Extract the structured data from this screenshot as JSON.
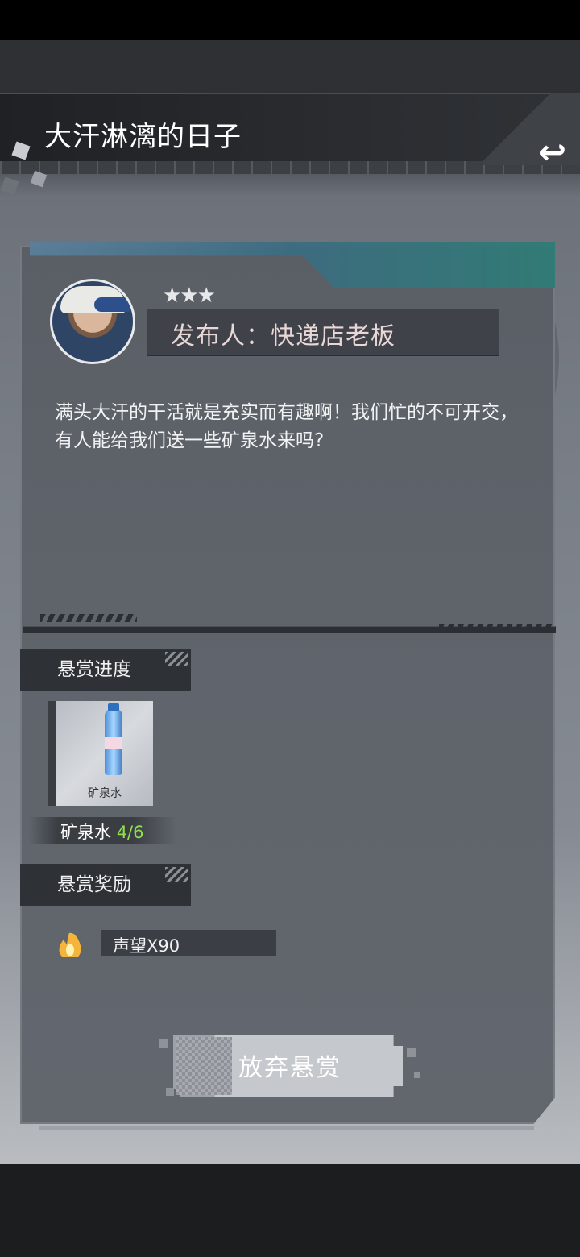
{
  "header": {
    "title": "大汗淋漓的日子",
    "back_icon": "↩"
  },
  "publisher": {
    "stars": "★★★",
    "label": "发布人：快递店老板"
  },
  "description": "满头大汗的干活就是充实而有趣啊！我们忙的不可开交，有人能给我们送一些矿泉水来吗?",
  "progress": {
    "section_label": "悬赏进度",
    "item_card_name": "矿泉水",
    "item_name": "矿泉水",
    "item_count": "4/6"
  },
  "reward": {
    "section_label": "悬赏奖励",
    "icon": "flame-icon",
    "text": "声望X90"
  },
  "actions": {
    "abandon_label": "放弃悬赏"
  },
  "colors": {
    "count_green": "#8fe04a",
    "panel_accent": "#2f7c76"
  }
}
